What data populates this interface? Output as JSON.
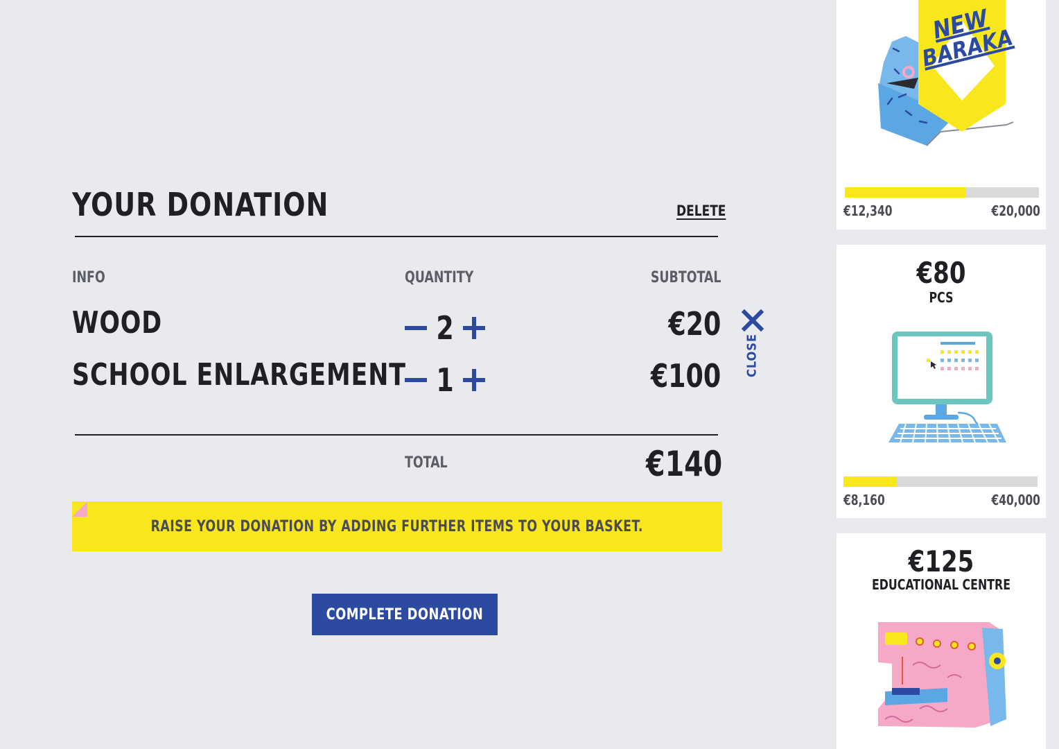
{
  "donation": {
    "title": "YOUR DONATION",
    "delete_label": "DELETE",
    "columns": {
      "info": "INFO",
      "quantity": "QUANTITY",
      "subtotal": "SUBTOTAL"
    },
    "items": [
      {
        "name": "WOOD",
        "quantity": "2",
        "subtotal": "€20"
      },
      {
        "name": "SCHOOL ENLARGEMENT",
        "quantity": "1",
        "subtotal": "€100"
      }
    ],
    "close_label": "CLOSE",
    "total_label": "TOTAL",
    "total_value": "€140",
    "notice": "RAISE YOUR DONATION BY ADDING FURTHER ITEMS TO YOUR BASKET.",
    "cta_label": "COMPLETE DONATION"
  },
  "sidebar": {
    "cards": [
      {
        "badge_line1": "NEW",
        "badge_line2": "BARAKA",
        "progress": 0.62,
        "raised": "€12,340",
        "goal": "€20,000"
      },
      {
        "price": "€80",
        "category": "PCS",
        "progress": 0.27,
        "raised": "€8,160",
        "goal": "€40,000"
      },
      {
        "price": "€125",
        "category": "EDUCATIONAL CENTRE"
      }
    ]
  },
  "colors": {
    "accent_blue": "#2b4aa0",
    "accent_yellow": "#f9e71e",
    "pink": "#f6a9c7",
    "background": "#e9eaee"
  }
}
